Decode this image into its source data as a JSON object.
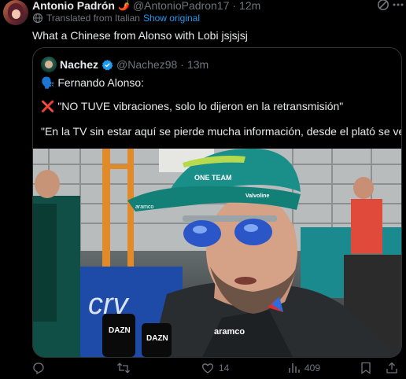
{
  "tweet": {
    "author_name": "Antonio Padrón",
    "author_emoji": "🌶️",
    "author_handle": "@AntonioPadron17",
    "separator": "·",
    "time": "12m",
    "translated_label": "Translated from Italian",
    "show_original_label": "Show original",
    "text": "What a Chinese from Alonso with Lobi jsjsjsj"
  },
  "quote": {
    "author_name": "Nachez",
    "author_handle": "@Nachez98",
    "separator": "·",
    "time": "13m",
    "line1": "🗣️ Fernando Alonso:",
    "line2": "❌ \"NO TUVE vibraciones, solo lo dijeron en la retransmisión\"",
    "line3": "\"En la TV sin estar aquí se pierde mucha información, desde el plató se ve ...",
    "media": {
      "cap_brand_top": "ONE TEAM",
      "cap_brand_side": "aramco",
      "cap_brand_valvoline": "Valvoline",
      "shirt_brand": "aramco",
      "mic_brand_a": "DAZN",
      "mic_brand_b": "DAZN"
    }
  },
  "actions": {
    "reply_count": "",
    "repost_count": "",
    "like_count": "14",
    "view_count": "409"
  },
  "colors": {
    "accent": "#1d9bf0",
    "muted": "#71767b",
    "text": "#e7e9ea",
    "border": "#2f3336",
    "background": "#000000"
  }
}
